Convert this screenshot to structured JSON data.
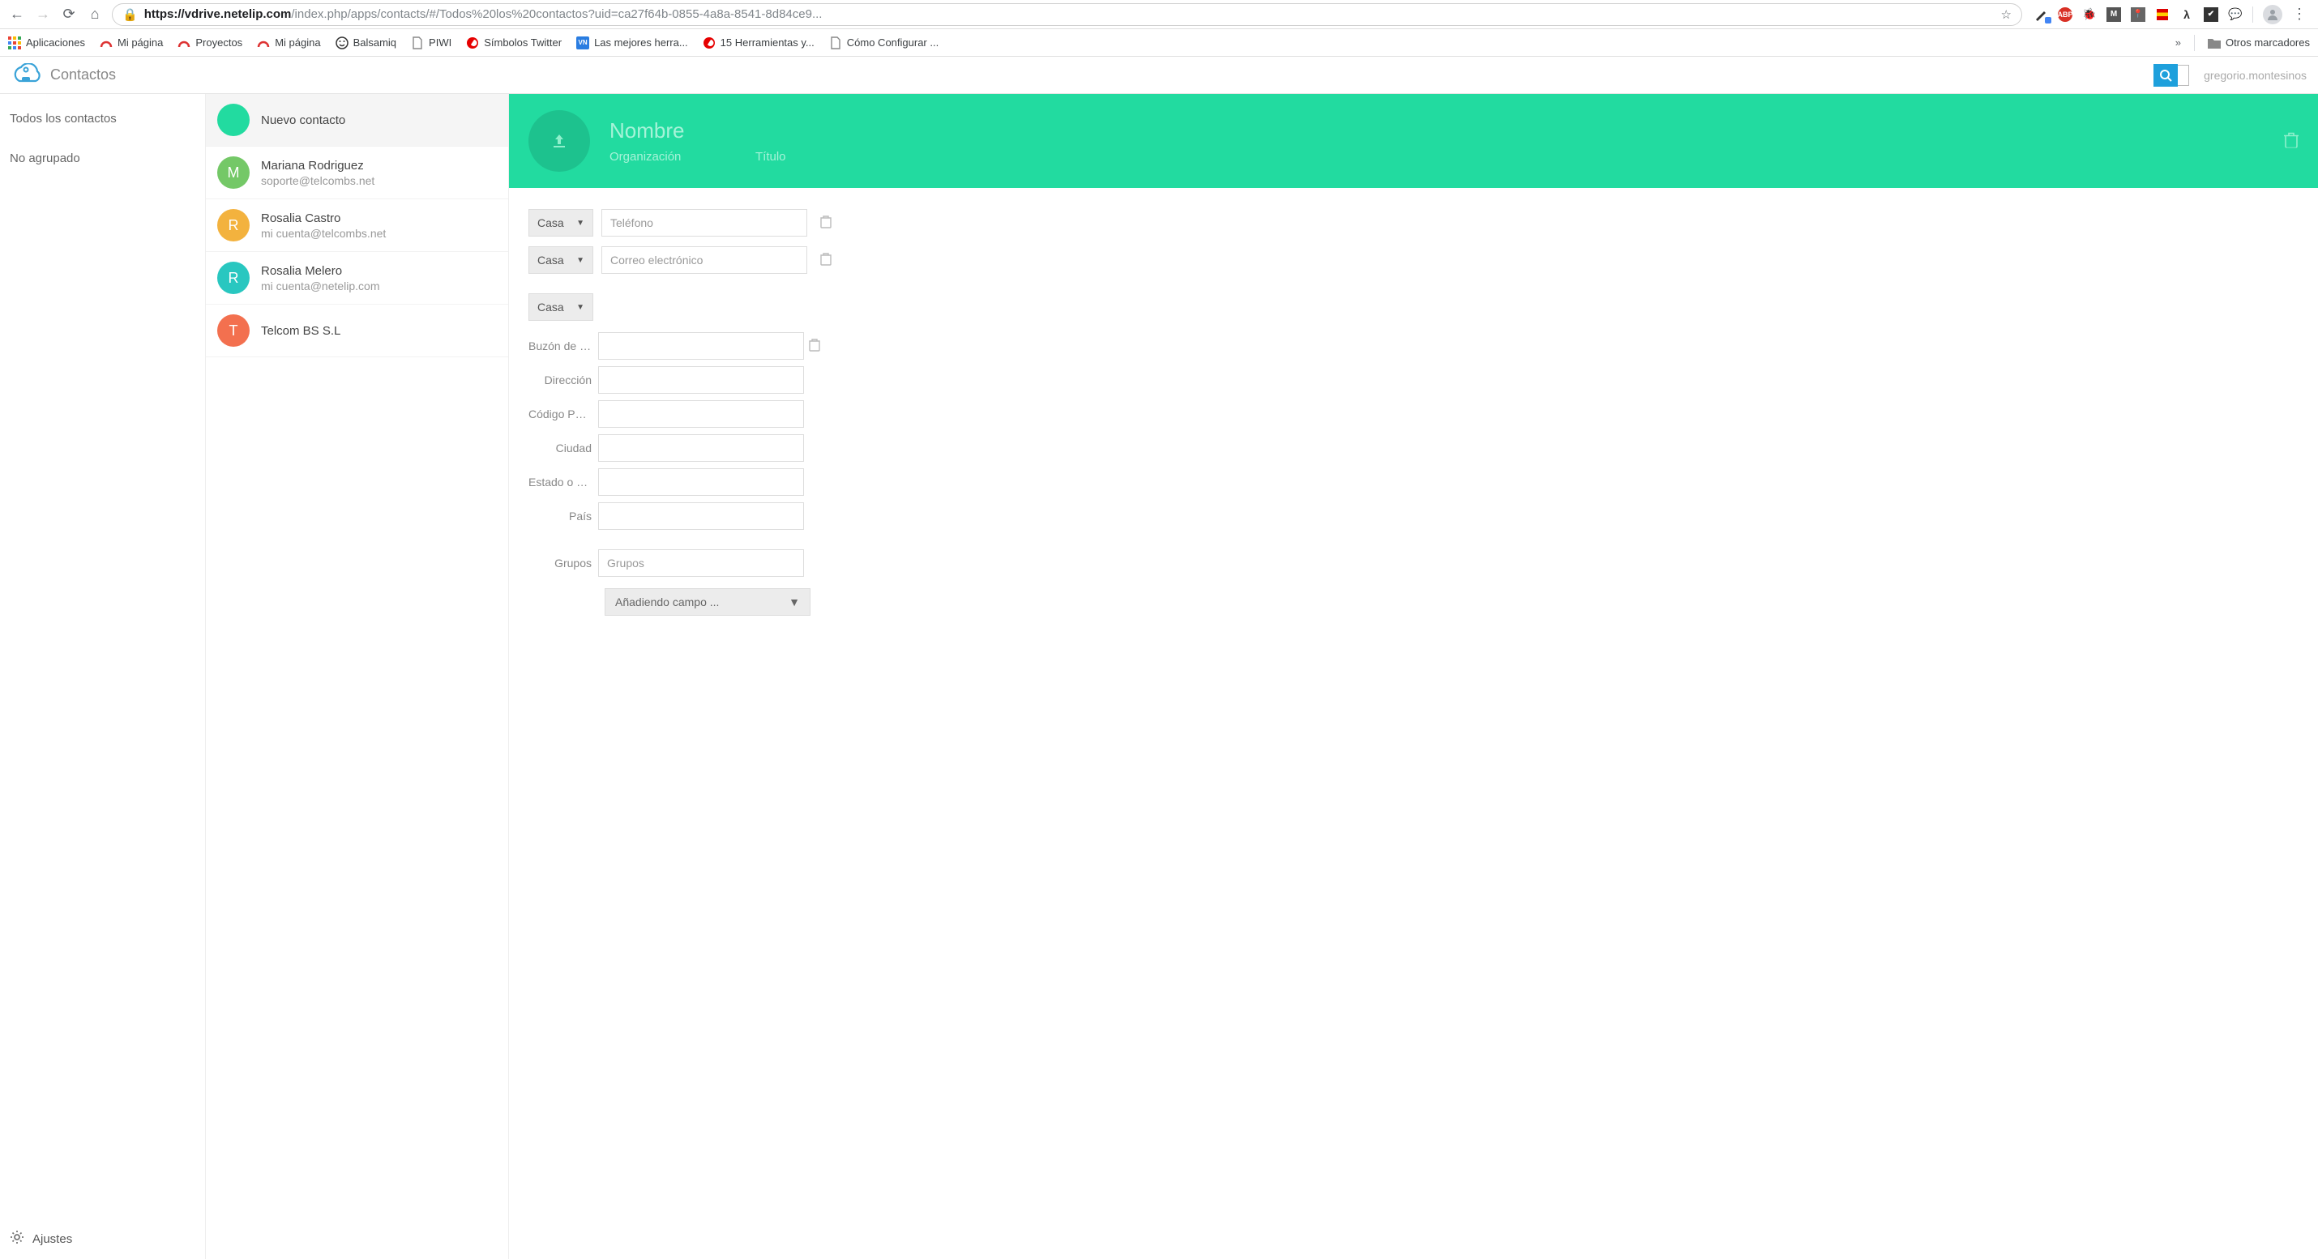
{
  "browser": {
    "url_host": "https://vdrive.netelip.com",
    "url_path": "/index.php/apps/contacts/#/Todos%20los%20contactos?uid=ca27f64b-0855-4a8a-8541-8d84ce9...",
    "bookmarks": [
      {
        "label": "Aplicaciones",
        "icon": "apps"
      },
      {
        "label": "Mi página",
        "icon": "arc-red"
      },
      {
        "label": "Proyectos",
        "icon": "arc-red"
      },
      {
        "label": "Mi página",
        "icon": "arc-red"
      },
      {
        "label": "Balsamiq",
        "icon": "smiley"
      },
      {
        "label": "PIWI",
        "icon": "doc"
      },
      {
        "label": "Símbolos Twitter",
        "icon": "vodafone"
      },
      {
        "label": "Las mejores herra...",
        "icon": "vn"
      },
      {
        "label": "15 Herramientas y...",
        "icon": "vodafone"
      },
      {
        "label": "Cómo Configurar ...",
        "icon": "doc"
      }
    ],
    "overflow": "»",
    "other_bookmarks": "Otros marcadores"
  },
  "header": {
    "app_title": "Contactos",
    "username": "gregorio.montesinos"
  },
  "groups": [
    "Todos los contactos",
    "No agrupado"
  ],
  "settings_label": "Ajustes",
  "contacts": [
    {
      "name": "Nuevo contacto",
      "sub": "",
      "initial": "",
      "color": "#22dba0",
      "new": true
    },
    {
      "name": "Mariana Rodriguez",
      "sub": "soporte@telcombs.net",
      "initial": "M",
      "color": "#74c867"
    },
    {
      "name": "Rosalia Castro",
      "sub": "mi cuenta@telcombs.net",
      "initial": "R",
      "color": "#f3b23e"
    },
    {
      "name": "Rosalia Melero",
      "sub": "mi cuenta@netelip.com",
      "initial": "R",
      "color": "#29c7c0"
    },
    {
      "name": "Telcom BS S.L",
      "sub": "",
      "initial": "T",
      "color": "#f3704f"
    }
  ],
  "detail": {
    "name_placeholder": "Nombre",
    "org_placeholder": "Organización",
    "title_placeholder": "Título",
    "type_home": "Casa",
    "phone_placeholder": "Teléfono",
    "email_placeholder": "Correo electrónico",
    "address_labels": {
      "pobox": "Buzón de c...",
      "address": "Dirección",
      "postal": "Código Postal",
      "city": "Ciudad",
      "state": "Estado o pr...",
      "country": "País"
    },
    "groups_label": "Grupos",
    "groups_placeholder": "Grupos",
    "add_field": "Añadiendo campo ..."
  }
}
